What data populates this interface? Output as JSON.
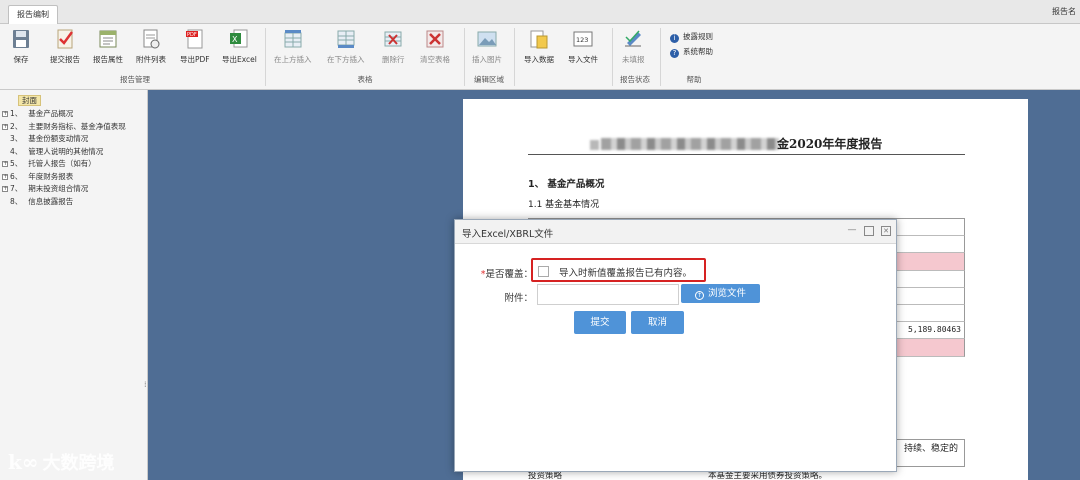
{
  "tab": {
    "label": "报告编制"
  },
  "top_right_text": "报告名",
  "ribbon": {
    "groups": [
      {
        "label": "报告管理"
      },
      {
        "label": "表格"
      },
      {
        "label": "编辑区域"
      },
      {
        "label": "报告状态"
      },
      {
        "label": "帮助"
      }
    ],
    "buttons": [
      {
        "label": "保存",
        "icon": "save-icon"
      },
      {
        "label": "提交报告",
        "icon": "submit-report-icon"
      },
      {
        "label": "报告属性",
        "icon": "report-properties-icon"
      },
      {
        "label": "附件列表",
        "icon": "attachment-list-icon"
      },
      {
        "label": "导出PDF",
        "icon": "pdf-icon"
      },
      {
        "label": "导出Excel",
        "icon": "excel-icon"
      },
      {
        "label": "在上方插入",
        "icon": "insert-above-icon"
      },
      {
        "label": "在下方插入",
        "icon": "insert-below-icon"
      },
      {
        "label": "删除行",
        "icon": "delete-row-icon"
      },
      {
        "label": "清空表格",
        "icon": "clear-table-icon"
      },
      {
        "label": "插入图片",
        "icon": "insert-image-icon"
      },
      {
        "label": "导入数据",
        "icon": "import-data-icon"
      },
      {
        "label": "导入文件",
        "icon": "import-file-icon"
      },
      {
        "label": "未填报",
        "icon": "unfilled-icon"
      }
    ],
    "help_items": [
      {
        "label": "披露规则",
        "icon": "info-icon"
      },
      {
        "label": "系统帮助",
        "icon": "help-icon"
      }
    ]
  },
  "sidebar": {
    "root": "封面",
    "items": [
      {
        "expand": "+",
        "num": "1、",
        "label": "基金产品概况"
      },
      {
        "expand": "+",
        "num": "2、",
        "label": "主要财务指标、基金净值表现"
      },
      {
        "expand": "",
        "num": "3、",
        "label": "基金份额变动情况"
      },
      {
        "expand": "",
        "num": "4、",
        "label": "管理人说明的其他情况"
      },
      {
        "expand": "+",
        "num": "5、",
        "label": "托管人报告（如有）"
      },
      {
        "expand": "+",
        "num": "6、",
        "label": "年度财务报表"
      },
      {
        "expand": "+",
        "num": "7、",
        "label": "期末投资组合情况"
      },
      {
        "expand": "",
        "num": "8、",
        "label": "信息披露报告"
      }
    ]
  },
  "document": {
    "title_suffix": "金2020年年度报告",
    "section1": "1、 基金产品概况",
    "section1_1": "1.1 基金基本情况",
    "table_value": "5,189.80463",
    "fragment_right": "持续、稳定的",
    "fragment_left": "投资策略",
    "fragment_mid": "本基金主要采用债券投资策略。"
  },
  "dialog": {
    "title": "导入Excel/XBRL文件",
    "overwrite_required_mark": "*",
    "overwrite_label": "是否覆盖：",
    "overwrite_option": "导入时新值覆盖报告已有内容。",
    "attachment_label": "附件：",
    "attachment_value": "",
    "browse_label": "浏览文件",
    "submit_label": "提交",
    "cancel_label": "取消"
  },
  "watermark": {
    "text": "大数跨境",
    "logo": "k∞"
  },
  "colors": {
    "accent_button": "#4f93d8",
    "highlight_border": "#d62222",
    "workspace_bg": "#4f6d94",
    "pink_row": "#f5c8cf"
  }
}
